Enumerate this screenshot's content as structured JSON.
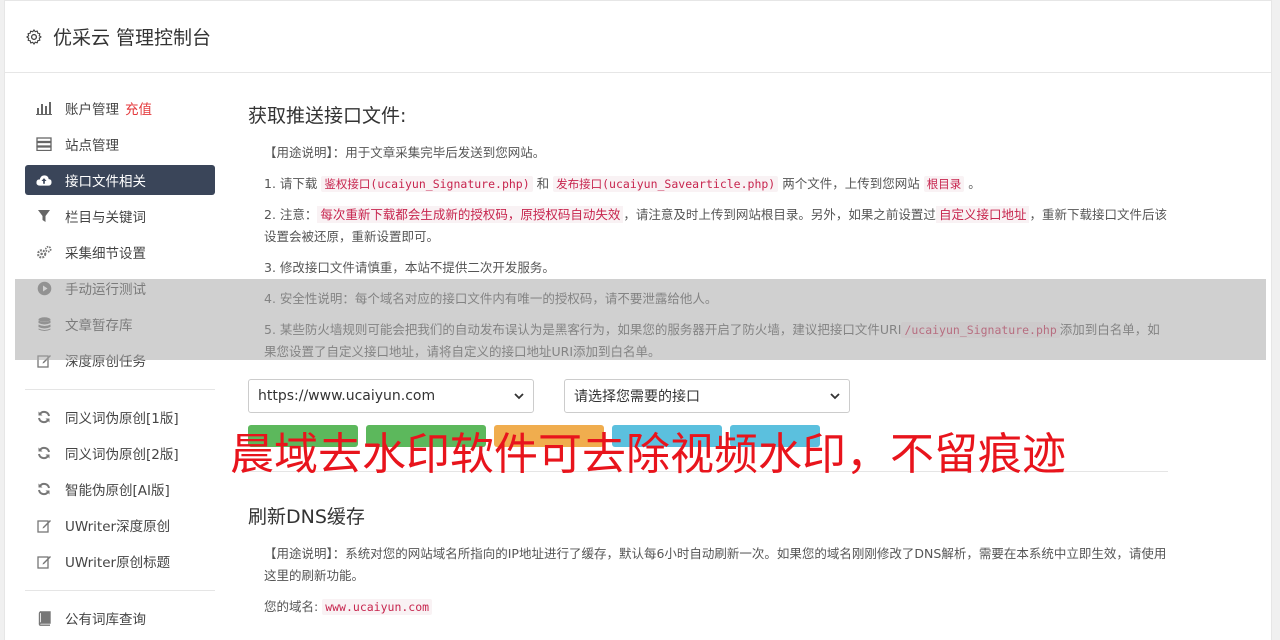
{
  "header": {
    "title": "优采云 管理控制台",
    "icon": "gear-icon"
  },
  "sidebar": {
    "group1": [
      {
        "label": "账户管理",
        "badge": "充值",
        "icon": "bar-chart-icon"
      },
      {
        "label": "站点管理",
        "icon": "server-icon"
      },
      {
        "label": "接口文件相关",
        "icon": "cloud-upload-icon",
        "active": true
      },
      {
        "label": "栏目与关键词",
        "icon": "filter-icon"
      },
      {
        "label": "采集细节设置",
        "icon": "cogs-icon"
      },
      {
        "label": "手动运行测试",
        "icon": "play-circle-icon"
      },
      {
        "label": "文章暂存库",
        "icon": "database-icon"
      },
      {
        "label": "深度原创任务",
        "icon": "edit-icon"
      }
    ],
    "group2": [
      {
        "label": "同义词伪原创[1版]",
        "icon": "refresh-icon"
      },
      {
        "label": "同义词伪原创[2版]",
        "icon": "refresh-icon"
      },
      {
        "label": "智能伪原创[AI版]",
        "icon": "refresh-icon"
      },
      {
        "label": "UWriter深度原创",
        "icon": "edit-icon"
      },
      {
        "label": "UWriter原创标题",
        "icon": "edit-icon"
      }
    ],
    "group3": [
      {
        "label": "公有词库查询",
        "icon": "book-icon"
      }
    ]
  },
  "section1": {
    "title": "获取推送接口文件:",
    "usage": "【用途说明】：用于文章采集完毕后发送到您网站。",
    "item1": {
      "a": "1. 请下载",
      "code1": "鉴权接口(ucaiyun_Signature.php)",
      "b": "和",
      "code2": "发布接口(ucaiyun_Savearticle.php)",
      "c": "两个文件，上传到您网站",
      "code3": "根目录",
      "d": "。"
    },
    "item2": {
      "a": "2. 注意：",
      "hl1": "每次重新下载都会生成新的授权码，原授权码自动失效",
      "b": "，请注意及时上传到网站根目录。另外，如果之前设置过",
      "hl2": "自定义接口地址",
      "c": "，重新下载接口文件后该设置会被还原，重新设置即可。"
    },
    "item3": "3. 修改接口文件请慎重，本站不提供二次开发服务。",
    "item4": "4. 安全性说明：每个域名对应的接口文件内有唯一的授权码，请不要泄露给他人。",
    "item5": {
      "a": "5. 某些防火墙规则可能会把我们的自动发布误认为是黑客行为，如果您的服务器开启了防火墙，建议把接口文件URI",
      "code": "/ucaiyun_Signature.php",
      "b": "添加到白名单，如果您设置了自定义接口地址，请将自定义的接口地址URI添加到白名单。"
    },
    "site_select": "https://www.ucaiyun.com",
    "api_select": "请选择您需要的接口"
  },
  "section2": {
    "title": "刷新DNS缓存",
    "usage": "【用途说明】：系统对您的网站域名所指向的IP地址进行了缓存，默认每6小时自动刷新一次。如果您的域名刚刚修改了DNS解析，需要在本系统中立即生效，请使用这里的刷新功能。",
    "domain_label": "您的域名:",
    "domain_value": "www.ucaiyun.com"
  },
  "watermark": "晨域去水印软件可去除视频水印，不留痕迹"
}
